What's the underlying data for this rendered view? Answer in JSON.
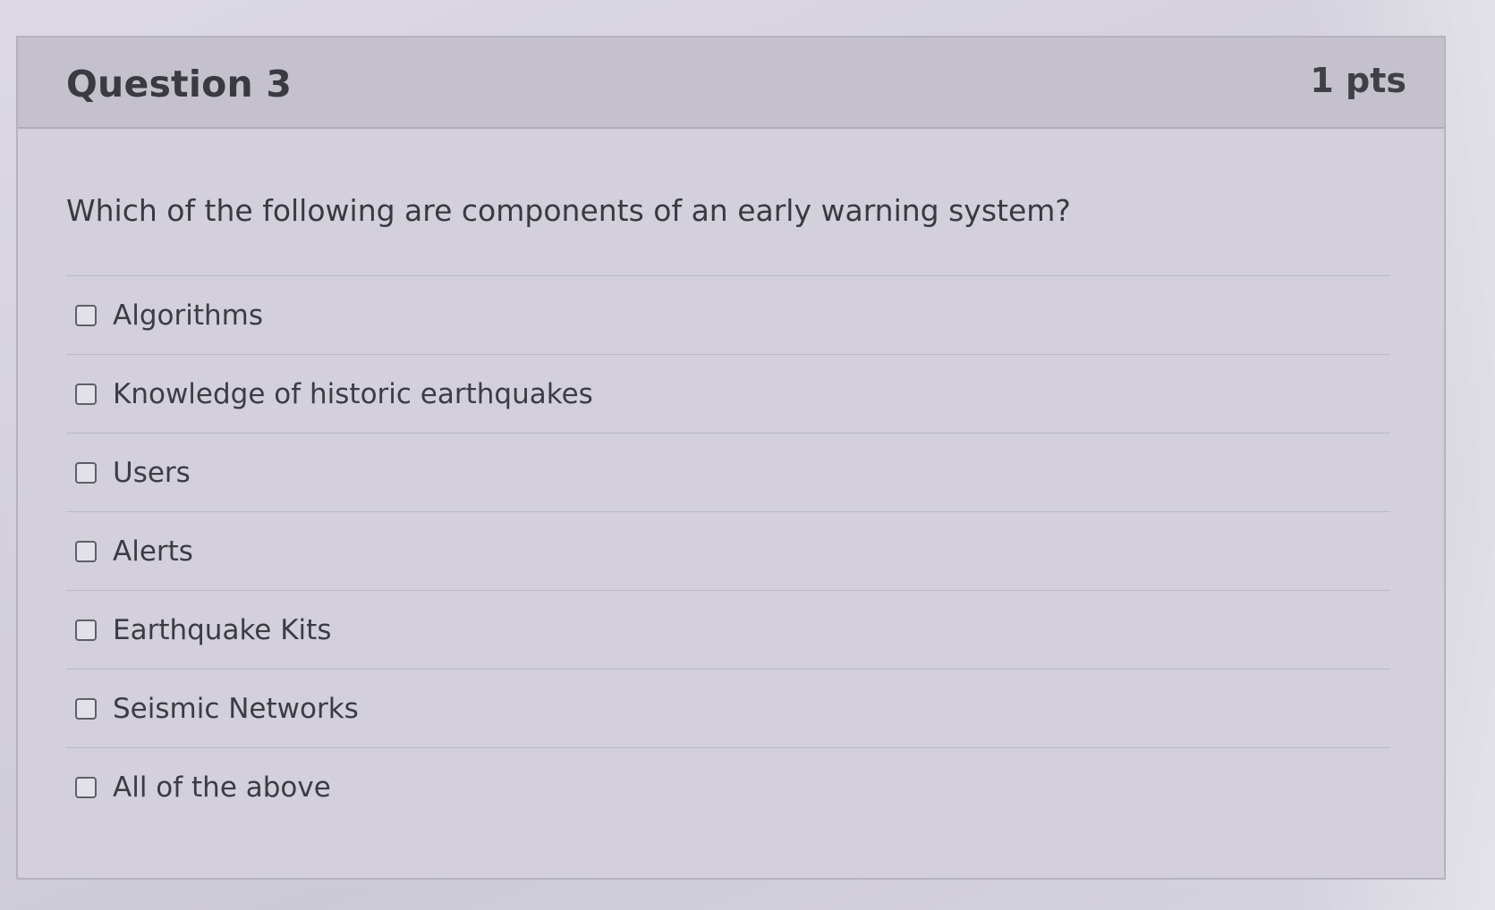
{
  "question": {
    "title": "Question 3",
    "points": "1 pts",
    "text": "Which of the following are components of an early warning system?"
  },
  "answers": [
    {
      "label": "Algorithms",
      "checked": false
    },
    {
      "label": "Knowledge of historic earthquakes",
      "checked": false
    },
    {
      "label": "Users",
      "checked": false
    },
    {
      "label": "Alerts",
      "checked": false
    },
    {
      "label": "Earthquake Kits",
      "checked": false
    },
    {
      "label": "Seismic Networks",
      "checked": false
    },
    {
      "label": "All of the above",
      "checked": false
    }
  ]
}
